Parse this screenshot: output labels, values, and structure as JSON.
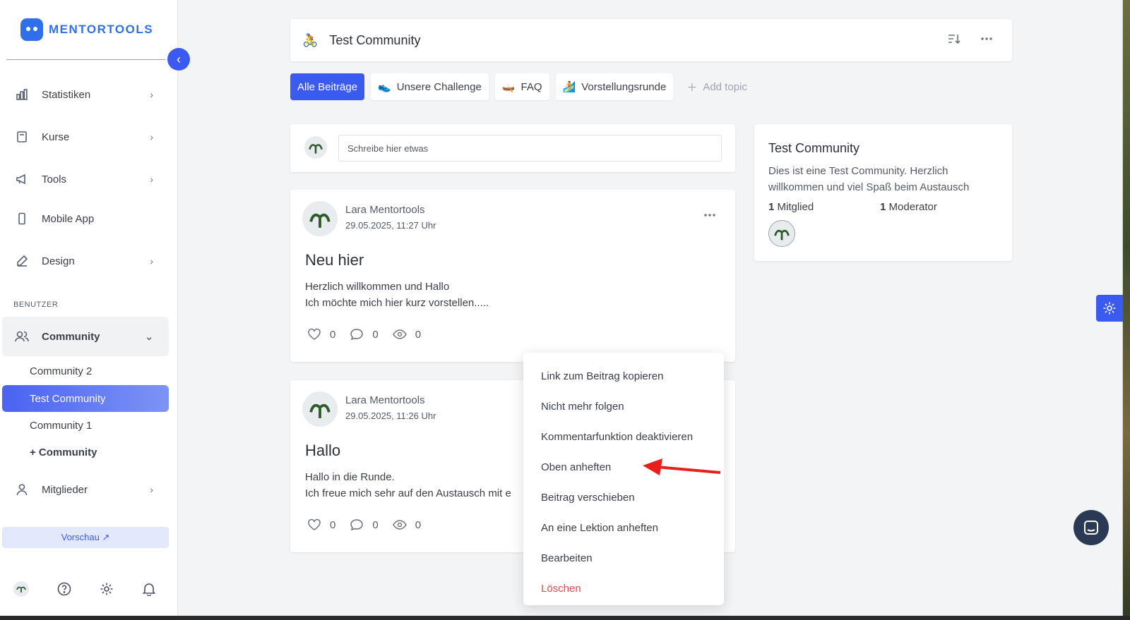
{
  "brand": {
    "name": "MENTORTOOLS"
  },
  "sidebar": {
    "nav": [
      {
        "label": "Statistiken",
        "icon": "bar-chart-icon"
      },
      {
        "label": "Kurse",
        "icon": "book-icon"
      },
      {
        "label": "Tools",
        "icon": "megaphone-icon"
      },
      {
        "label": "Mobile App",
        "icon": "phone-icon"
      },
      {
        "label": "Design",
        "icon": "pencil-icon"
      }
    ],
    "section_label": "BENUTZER",
    "community": {
      "label": "Community",
      "icon": "users-icon"
    },
    "community_items": [
      "Community 2",
      "Test Community",
      "Community 1",
      "+ Community"
    ],
    "members": {
      "label": "Mitglieder",
      "icon": "user-icon"
    },
    "preview_label": "Vorschau ↗"
  },
  "header": {
    "emoji": "🚴",
    "title": "Test Community"
  },
  "topics": [
    {
      "label": "Alle Beiträge",
      "emoji": ""
    },
    {
      "label": "Unsere Challenge",
      "emoji": "👟"
    },
    {
      "label": "FAQ",
      "emoji": "🛶"
    },
    {
      "label": "Vorstellungsrunde",
      "emoji": "🏄"
    }
  ],
  "add_topic_label": "Add topic",
  "composer": {
    "placeholder": "Schreibe hier etwas"
  },
  "posts": [
    {
      "author": "Lara Mentortools",
      "date": "29.05.2025, 11:27 Uhr",
      "title": "Neu hier",
      "body_line1": "Herzlich willkommen und Hallo",
      "body_line2": "Ich möchte mich hier kurz vorstellen.....",
      "likes": "0",
      "comments": "0",
      "views": "0"
    },
    {
      "author": "Lara Mentortools",
      "date": "29.05.2025, 11:26 Uhr",
      "title": "Hallo",
      "body_line1": "Hallo in die Runde.",
      "body_line2": "Ich freue mich sehr auf den Austausch mit e",
      "likes": "0",
      "comments": "0",
      "views": "0"
    }
  ],
  "info": {
    "title": "Test Community",
    "description": "Dies ist eine Test Community. Herzlich willkommen und viel Spaß beim Austausch",
    "members_count": "1",
    "members_label": "Mitglied",
    "moderators_count": "1",
    "moderators_label": "Moderator"
  },
  "context_menu": [
    "Link zum Beitrag kopieren",
    "Nicht mehr folgen",
    "Kommentarfunktion deaktivieren",
    "Oben anheften",
    "Beitrag verschieben",
    "An eine Lektion anheften",
    "Bearbeiten",
    "Löschen"
  ],
  "colors": {
    "accent": "#3b5bf0",
    "danger": "#e5484d",
    "annotation": "#e8201c"
  }
}
